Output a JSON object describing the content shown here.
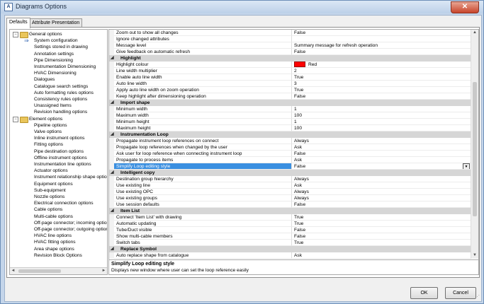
{
  "window": {
    "title": "Diagrams Options",
    "icon_letter": "A",
    "close_glyph": "✕"
  },
  "tabs": [
    "Defaults",
    "Attribute Presentation"
  ],
  "tree": [
    {
      "label": "General options",
      "level": 0,
      "folder": true,
      "expander": "−"
    },
    {
      "label": "System configuration",
      "level": 1,
      "selected": true
    },
    {
      "label": "Settings stored in drawing",
      "level": 1
    },
    {
      "label": "Annotation settings",
      "level": 1
    },
    {
      "label": "Pipe Dimensioning",
      "level": 1
    },
    {
      "label": "Instrumentation Dimensioning",
      "level": 1
    },
    {
      "label": "HVAC Dimensioning",
      "level": 1
    },
    {
      "label": "Dialogues",
      "level": 1
    },
    {
      "label": "Catalogue search settings",
      "level": 1
    },
    {
      "label": "Auto formatting rules options",
      "level": 1
    },
    {
      "label": "Consistency rules options",
      "level": 1
    },
    {
      "label": "Unassigned Items",
      "level": 1
    },
    {
      "label": "Revision handling options",
      "level": 1
    },
    {
      "label": "Element options",
      "level": 0,
      "folder": true,
      "expander": "−"
    },
    {
      "label": "Pipeline options",
      "level": 1
    },
    {
      "label": "Valve options",
      "level": 1
    },
    {
      "label": "Inline instrument options",
      "level": 1
    },
    {
      "label": "Fitting options",
      "level": 1
    },
    {
      "label": "Pipe destination options",
      "level": 1
    },
    {
      "label": "Offline instrument options",
      "level": 1
    },
    {
      "label": "Instrumentation line options",
      "level": 1
    },
    {
      "label": "Actuator options",
      "level": 1
    },
    {
      "label": "Instrument relationship shape options",
      "level": 1
    },
    {
      "label": "Equipment options",
      "level": 1
    },
    {
      "label": "Sub-equipment",
      "level": 1
    },
    {
      "label": "Nozzle options",
      "level": 1
    },
    {
      "label": "Electrical connection options",
      "level": 1
    },
    {
      "label": "Cable options",
      "level": 1
    },
    {
      "label": "Multi-cable options",
      "level": 1
    },
    {
      "label": "Off-page connector; incoming options",
      "level": 1
    },
    {
      "label": "Off-page connector; outgoing options",
      "level": 1
    },
    {
      "label": "HVAC line options",
      "level": 1
    },
    {
      "label": "HVAC fitting options",
      "level": 1
    },
    {
      "label": "Area shape options",
      "level": 1
    },
    {
      "label": "Revision Block Options",
      "level": 1
    }
  ],
  "tree_scroll": {
    "left": "◄",
    "right": "►"
  },
  "grid": [
    {
      "name": "Zoom out to show all changes",
      "value": "False"
    },
    {
      "name": "Ignore changed attributes",
      "value": ""
    },
    {
      "name": "Message level",
      "value": "Summary message for refresh operation"
    },
    {
      "name": "Give feedback on automatic refresh",
      "value": "False"
    },
    {
      "name": "Highlight",
      "cat": true
    },
    {
      "name": "Highlight colour",
      "value": "Red",
      "swatch": true
    },
    {
      "name": "Line width multiplier",
      "value": "2"
    },
    {
      "name": "Enable auto line width",
      "value": "True"
    },
    {
      "name": "Auto line width",
      "value": "3"
    },
    {
      "name": "Apply auto line width on zoom operation",
      "value": "True"
    },
    {
      "name": "Keep highlight after dimensioning operation",
      "value": "False"
    },
    {
      "name": "Import shape",
      "cat": true
    },
    {
      "name": "Minimum width",
      "value": "1"
    },
    {
      "name": "Maximum width",
      "value": "100"
    },
    {
      "name": "Minimum height",
      "value": "1"
    },
    {
      "name": "Maximum height",
      "value": "100"
    },
    {
      "name": "Instrumentation Loop",
      "cat": true
    },
    {
      "name": "Propagate instrument loop references on connect",
      "value": "Always"
    },
    {
      "name": "Propagate loop references when changed by the user",
      "value": "Ask"
    },
    {
      "name": "Ask user for loop reference when connecting instrument loop",
      "value": "False"
    },
    {
      "name": "Propagate to process items",
      "value": "Ask"
    },
    {
      "name": "Simplify Loop editing style",
      "value": "False",
      "selected": true,
      "dropdown": true
    },
    {
      "name": "Intelligent copy",
      "cat": true
    },
    {
      "name": "Destination group hierarchy",
      "value": "Always"
    },
    {
      "name": "Use existing line",
      "value": "Ask"
    },
    {
      "name": "Use existing OPC",
      "value": "Always"
    },
    {
      "name": "Use existing groups",
      "value": "Always"
    },
    {
      "name": "Use session defaults",
      "value": "False"
    },
    {
      "name": "Item List",
      "cat": true
    },
    {
      "name": "Connect 'Item List' with drawing",
      "value": "True"
    },
    {
      "name": "Automatic updating",
      "value": "True"
    },
    {
      "name": "Tube/Duct visible",
      "value": "False"
    },
    {
      "name": "Show multi-cable members",
      "value": "False"
    },
    {
      "name": "Switch tabs",
      "value": "True"
    },
    {
      "name": "Replace Symbol",
      "cat": true
    },
    {
      "name": "Auto replace shape from catalogue",
      "value": "Ask"
    }
  ],
  "grid_scroll": {
    "up": "▲",
    "down": "▼"
  },
  "category_arrow": "◢",
  "dropdown_glyph": "▼",
  "description": {
    "title": "Simplify Loop editing style",
    "text": "Displays new window where user can set the loop reference easily"
  },
  "buttons": {
    "ok": "OK",
    "cancel": "Cancel"
  },
  "colors": {
    "highlight": "#ff0000",
    "selection": "#3a8fe0",
    "category_bg": "#d6d6d6"
  }
}
